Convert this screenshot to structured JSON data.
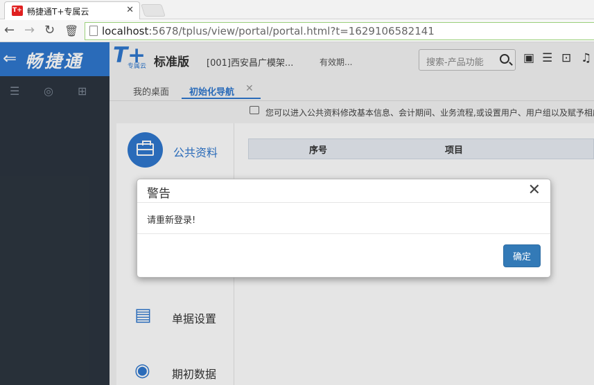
{
  "browser": {
    "tab_title": "畅捷通T+专属云",
    "favicon_text": "T+",
    "url_host": "localhost",
    "url_path": ":5678/tplus/view/portal/portal.html?t=1629106582141"
  },
  "header": {
    "brand": "畅捷通",
    "product_logo": "T+",
    "product_sub": "专属云",
    "edition": "标准版",
    "company": "[001]西安昌广模架...",
    "validity": "有效期...",
    "search_placeholder": "搜索-产品功能"
  },
  "tabs": [
    {
      "label": "我的桌面",
      "active": false
    },
    {
      "label": "初始化导航",
      "active": true
    }
  ],
  "info_text": "您可以进入公共资料修改基本信息、会计期间、业务流程,或设置用户、用户组以及赋予相应",
  "categories": [
    {
      "label": "公共资料",
      "icon": "briefcase-icon",
      "active": true
    },
    {
      "label": "单据设置",
      "icon": "document-gear-icon",
      "active": false
    },
    {
      "label": "期初数据",
      "icon": "database-icon",
      "active": false
    }
  ],
  "table": {
    "headers": [
      "序号",
      "项目"
    ]
  },
  "modal": {
    "title": "警告",
    "message": "请重新登录!",
    "ok_label": "确定"
  },
  "colors": {
    "brand_blue": "#2f78cf",
    "sidebar_dark": "#2c3540",
    "button_blue": "#337ab7"
  }
}
